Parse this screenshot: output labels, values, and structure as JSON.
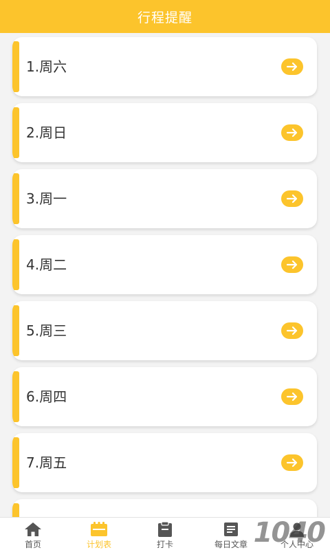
{
  "header": {
    "title": "行程提醒"
  },
  "schedule": {
    "items": [
      {
        "label": "1.周六",
        "icon": "arrow-right-icon"
      },
      {
        "label": "2.周日",
        "icon": "arrow-right-icon"
      },
      {
        "label": "3.周一",
        "icon": "arrow-right-icon"
      },
      {
        "label": "4.周二",
        "icon": "arrow-right-icon"
      },
      {
        "label": "5.周三",
        "icon": "arrow-right-icon"
      },
      {
        "label": "6.周四",
        "icon": "arrow-right-icon"
      },
      {
        "label": "7.周五",
        "icon": "arrow-right-icon"
      }
    ]
  },
  "tabbar": {
    "items": [
      {
        "label": "首页",
        "icon": "home-icon",
        "active": false
      },
      {
        "label": "计划表",
        "icon": "calendar-icon",
        "active": true
      },
      {
        "label": "打卡",
        "icon": "clipboard-icon",
        "active": false
      },
      {
        "label": "每日文章",
        "icon": "article-icon",
        "active": false
      },
      {
        "label": "个人中心",
        "icon": "user-icon",
        "active": false
      }
    ]
  },
  "watermark": {
    "text": "1040"
  },
  "colors": {
    "accent": "#fcc42c",
    "text": "#333333",
    "background": "#f3f3f3"
  }
}
